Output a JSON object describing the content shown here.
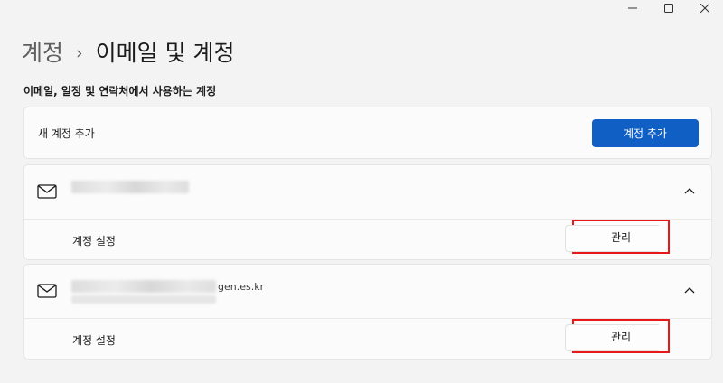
{
  "window": {
    "controls": {
      "minimize_icon": "minimize-icon",
      "maximize_icon": "maximize-icon",
      "close_icon": "close-icon"
    }
  },
  "breadcrumb": {
    "parent": "계정",
    "separator": "›",
    "current": "이메일 및 계정"
  },
  "section": {
    "label": "이메일, 일정 및 연락처에서 사용하는 계정"
  },
  "add_account": {
    "label": "새 계정 추가",
    "button_label": "계정 추가"
  },
  "accounts": [
    {
      "icon": "mail-icon",
      "email_visible_part": "",
      "expanded": true,
      "settings_label": "계정 설정",
      "manage_label": "관리"
    },
    {
      "icon": "mail-icon",
      "email_visible_part": "gen.es.kr",
      "expanded": true,
      "settings_label": "계정 설정",
      "manage_label": "관리"
    }
  ],
  "colors": {
    "accent": "#0f5fc4",
    "highlight": "#e81818",
    "background": "#f3f3f3",
    "card": "#fbfbfb"
  }
}
